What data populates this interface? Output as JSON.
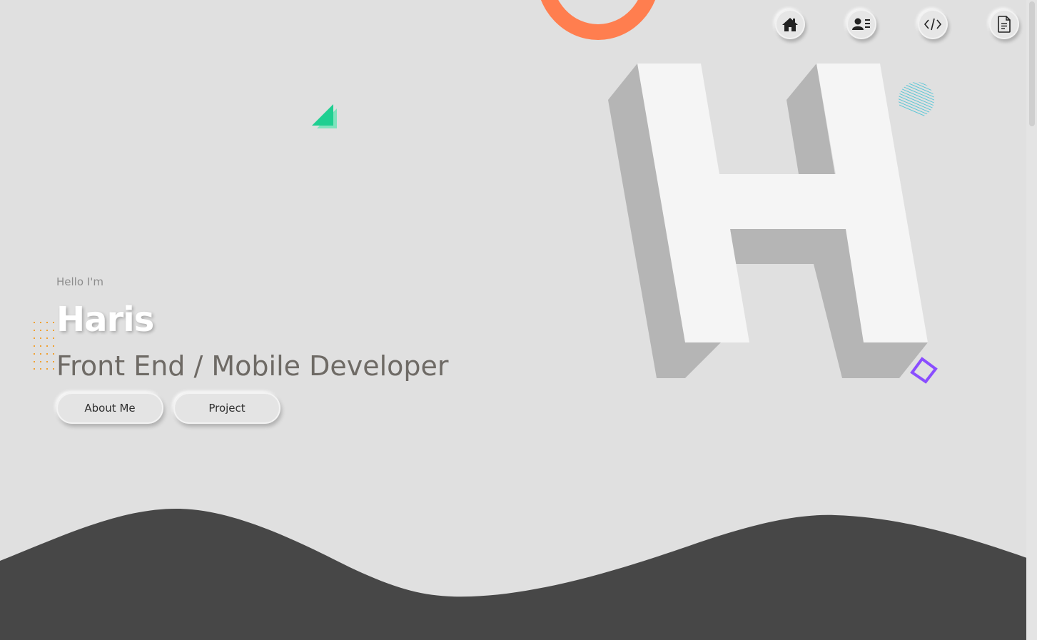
{
  "nav": {
    "items": [
      {
        "icon": "home-icon"
      },
      {
        "icon": "contact-card-icon"
      },
      {
        "icon": "code-icon"
      },
      {
        "icon": "document-icon"
      }
    ]
  },
  "hero": {
    "greeting": "Hello I'm",
    "name": "Haris",
    "role": "Front End / Mobile Developer",
    "about_button": "About Me",
    "project_button": "Project"
  },
  "colors": {
    "background": "#e0e0e0",
    "wave": "#474747",
    "ring": "#ff7e4f",
    "triangle": "#1fcf91",
    "diamond": "#8a4dff",
    "stripes": "#5cc6d6",
    "dots": "#f0a030",
    "h_face": "#f5f5f5",
    "h_side": "#b5b5b5"
  }
}
